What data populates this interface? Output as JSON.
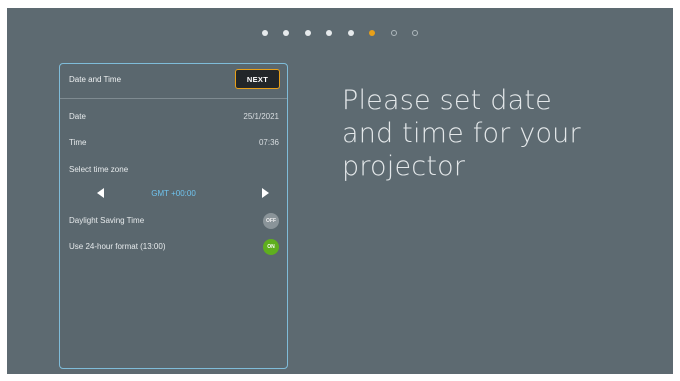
{
  "progress": {
    "total_steps": 8,
    "current_step": 6,
    "dots": [
      "done",
      "done",
      "done",
      "done",
      "done",
      "current",
      "todo",
      "todo"
    ]
  },
  "colors": {
    "accent": "#e8a019",
    "panel_border": "#7fbcd9",
    "timezone_text": "#6fc3ee",
    "toggle_on": "#5faf1e",
    "toggle_off": "#8a9499"
  },
  "panel": {
    "title": "Date and Time",
    "next_label": "NEXT",
    "date": {
      "label": "Date",
      "value": "25/1/2021"
    },
    "time": {
      "label": "Time",
      "value": "07:36"
    },
    "timezone": {
      "label": "Select time zone",
      "value": "GMT +00:00",
      "prev_icon": "triangle-left-icon",
      "next_icon": "triangle-right-icon"
    },
    "daylight_saving": {
      "label": "Daylight Saving Time",
      "state": "OFF"
    },
    "hour_format": {
      "label": "Use 24-hour format (13:00)",
      "state": "ON"
    }
  },
  "message": {
    "line1": "Please set date",
    "line2": "and time for your",
    "line3": "projector"
  }
}
